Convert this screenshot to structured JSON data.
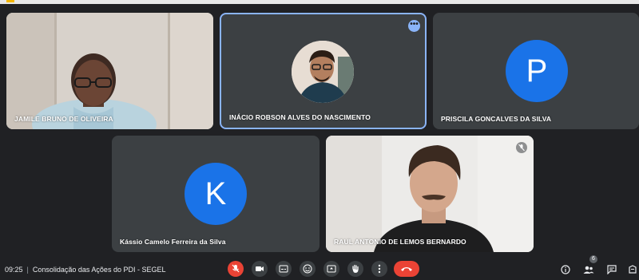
{
  "participants": [
    {
      "name": "JAMILE BRUNO DE OLIVEIRA",
      "type": "video"
    },
    {
      "name": "INÁCIO ROBSON ALVES DO NASCIMENTO",
      "type": "photo-avatar",
      "active_speaker": true
    },
    {
      "name": "PRISCILA GONCALVES DA SILVA",
      "type": "letter-avatar",
      "letter": "P"
    },
    {
      "name": "Kássio Camelo Ferreira da Silva",
      "type": "letter-avatar",
      "letter": "K"
    },
    {
      "name": "RAUL ANTONIO DE LEMOS BERNARDO",
      "type": "video",
      "muted": true
    }
  ],
  "meeting": {
    "time": "09:25",
    "separator": "|",
    "title": "Consolidação das Ações do PDI - SEGEL"
  },
  "people_count": "6",
  "colors": {
    "background": "#202124",
    "tile": "#3c4043",
    "avatar": "#1a73e8",
    "active_border": "#8ab4f8",
    "danger": "#ea4335"
  },
  "icons": {
    "controls": [
      "mic-off-icon",
      "camera-icon",
      "captions-icon",
      "emoji-icon",
      "present-icon",
      "raise-hand-icon",
      "more-options-icon",
      "hang-up-icon"
    ],
    "side": [
      "info-icon",
      "people-icon",
      "chat-icon",
      "activities-icon"
    ]
  }
}
